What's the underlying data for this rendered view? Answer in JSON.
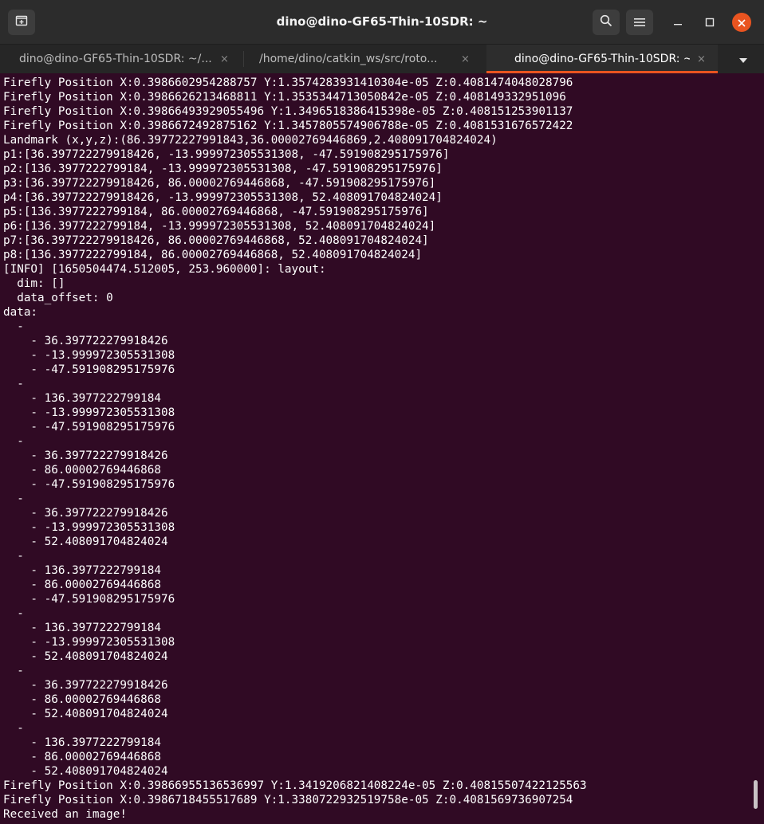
{
  "window": {
    "title": "dino@dino-GF65-Thin-10SDR: ~"
  },
  "tabs": [
    {
      "label": "dino@dino-GF65-Thin-10SDR: ~/...",
      "close": "×"
    },
    {
      "label": "/home/dino/catkin_ws/src/roto...",
      "close": "×"
    },
    {
      "label": "dino@dino-GF65-Thin-10SDR: ~",
      "close": "×"
    }
  ],
  "icons": {
    "new_tab": "new-tab-icon",
    "search": "search-icon",
    "menu": "hamburger-menu-icon",
    "minimize": "minimize-icon",
    "maximize": "maximize-icon",
    "close": "close-icon",
    "tab_list": "chevron-down-icon"
  },
  "colors": {
    "terminal_bg": "#300a24",
    "accent": "#e95420",
    "text": "#ffffff"
  },
  "terminal": {
    "lines": [
      "Firefly Position X:0.3986602954288757 Y:1.3574283931410304e-05 Z:0.4081474048028796",
      "Firefly Position X:0.3986626213468811 Y:1.3535344713050842e-05 Z:0.408149332951096",
      "Firefly Position X:0.39866493929055496 Y:1.3496518386415398e-05 Z:0.408151253901137",
      "Firefly Position X:0.3986672492875162 Y:1.3457805574906788e-05 Z:0.4081531676572422",
      "Landmark (x,y,z):(86.39772227991843,36.00002769446869,2.408091704824024)",
      "p1:[36.397722279918426, -13.999972305531308, -47.591908295175976]",
      "p2:[136.3977222799184, -13.999972305531308, -47.591908295175976]",
      "p3:[36.397722279918426, 86.00002769446868, -47.591908295175976]",
      "p4:[36.397722279918426, -13.999972305531308, 52.408091704824024]",
      "p5:[136.3977222799184, 86.00002769446868, -47.591908295175976]",
      "p6:[136.3977222799184, -13.999972305531308, 52.408091704824024]",
      "p7:[36.397722279918426, 86.00002769446868, 52.408091704824024]",
      "p8:[136.3977222799184, 86.00002769446868, 52.408091704824024]",
      "[INFO] [1650504474.512005, 253.960000]: layout:",
      "  dim: []",
      "  data_offset: 0",
      "data:",
      "  -",
      "    - 36.397722279918426",
      "    - -13.999972305531308",
      "    - -47.591908295175976",
      "  -",
      "    - 136.3977222799184",
      "    - -13.999972305531308",
      "    - -47.591908295175976",
      "  -",
      "    - 36.397722279918426",
      "    - 86.00002769446868",
      "    - -47.591908295175976",
      "  -",
      "    - 36.397722279918426",
      "    - -13.999972305531308",
      "    - 52.408091704824024",
      "  -",
      "    - 136.3977222799184",
      "    - 86.00002769446868",
      "    - -47.591908295175976",
      "  -",
      "    - 136.3977222799184",
      "    - -13.999972305531308",
      "    - 52.408091704824024",
      "  -",
      "    - 36.397722279918426",
      "    - 86.00002769446868",
      "    - 52.408091704824024",
      "  -",
      "    - 136.3977222799184",
      "    - 86.00002769446868",
      "    - 52.408091704824024",
      "Firefly Position X:0.39866955136536997 Y:1.3419206821408224e-05 Z:0.40815507422125563",
      "Firefly Position X:0.3986718455517689 Y:1.3380722932519758e-05 Z:0.4081569736907254",
      "Received an image!"
    ]
  }
}
